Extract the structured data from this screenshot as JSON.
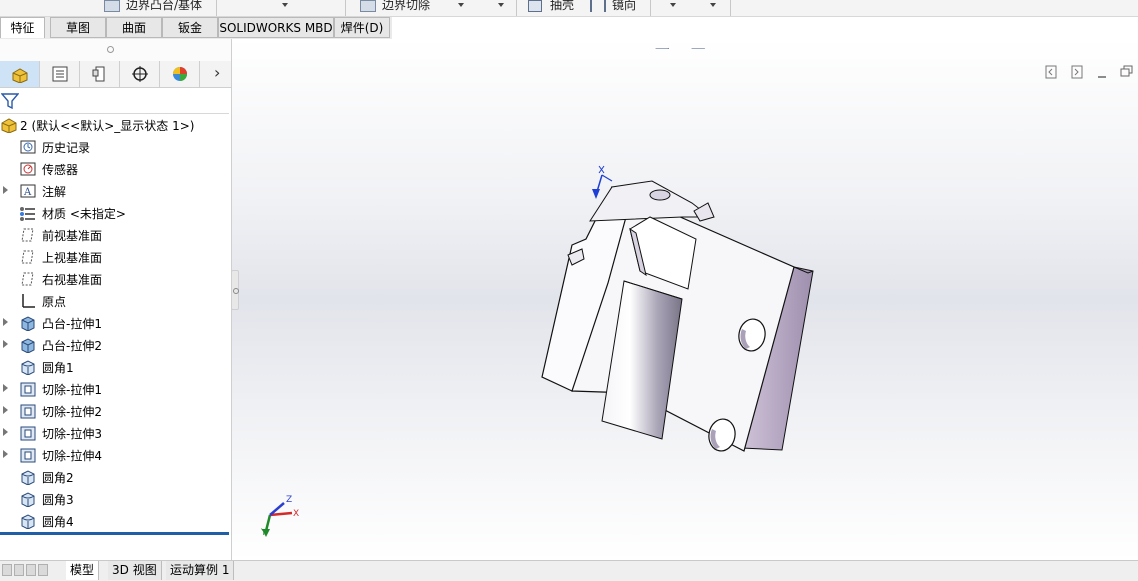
{
  "ribbon_top": {
    "items": [
      "边界凸台/基体",
      "边界切除",
      "抽壳",
      "镜向"
    ]
  },
  "tabs": [
    {
      "label": "特征",
      "active": true
    },
    {
      "label": "草图"
    },
    {
      "label": "曲面"
    },
    {
      "label": "钣金"
    },
    {
      "label": "SOLIDWORKS MBD"
    },
    {
      "label": "焊件(D)"
    }
  ],
  "panel": {
    "manager_tabs": [
      "feature-manager",
      "property-manager",
      "configuration-manager",
      "dimxpert-manager",
      "display-manager"
    ],
    "expand_more": "›",
    "tree": [
      {
        "label": "2  (默认<<默认>_显示状态 1>)",
        "icon": "part-icon",
        "expandable": false
      },
      {
        "label": "历史记录",
        "icon": "history-icon",
        "expandable": false
      },
      {
        "label": "传感器",
        "icon": "sensor-icon",
        "expandable": false
      },
      {
        "label": "注解",
        "icon": "annotation-icon",
        "expandable": true
      },
      {
        "label": "材质 <未指定>",
        "icon": "material-icon",
        "expandable": false
      },
      {
        "label": "前视基准面",
        "icon": "plane-icon",
        "expandable": false
      },
      {
        "label": "上视基准面",
        "icon": "plane-icon",
        "expandable": false
      },
      {
        "label": "右视基准面",
        "icon": "plane-icon",
        "expandable": false
      },
      {
        "label": "原点",
        "icon": "origin-icon",
        "expandable": false
      },
      {
        "label": "凸台-拉伸1",
        "icon": "boss-extrude-icon",
        "expandable": true
      },
      {
        "label": "凸台-拉伸2",
        "icon": "boss-extrude-icon",
        "expandable": true
      },
      {
        "label": "圆角1",
        "icon": "fillet-icon",
        "expandable": false
      },
      {
        "label": "切除-拉伸1",
        "icon": "cut-extrude-icon",
        "expandable": true
      },
      {
        "label": "切除-拉伸2",
        "icon": "cut-extrude-icon",
        "expandable": true
      },
      {
        "label": "切除-拉伸3",
        "icon": "cut-extrude-icon",
        "expandable": true
      },
      {
        "label": "切除-拉伸4",
        "icon": "cut-extrude-icon",
        "expandable": true
      },
      {
        "label": "圆角2",
        "icon": "fillet-icon",
        "expandable": false
      },
      {
        "label": "圆角3",
        "icon": "fillet-icon",
        "expandable": false
      },
      {
        "label": "圆角4",
        "icon": "fillet-icon",
        "expandable": false
      }
    ]
  },
  "triad": {
    "x": "X",
    "y": "Y",
    "z": "Z"
  },
  "bottom_tabs": [
    {
      "label": "模型",
      "active": true
    },
    {
      "label": "3D 视图"
    },
    {
      "label": "运动算例 1"
    }
  ],
  "colors": {
    "accent": "#1f5fa8",
    "part_face": "#f4f4f8",
    "part_shadow": "#b8a9c4"
  }
}
